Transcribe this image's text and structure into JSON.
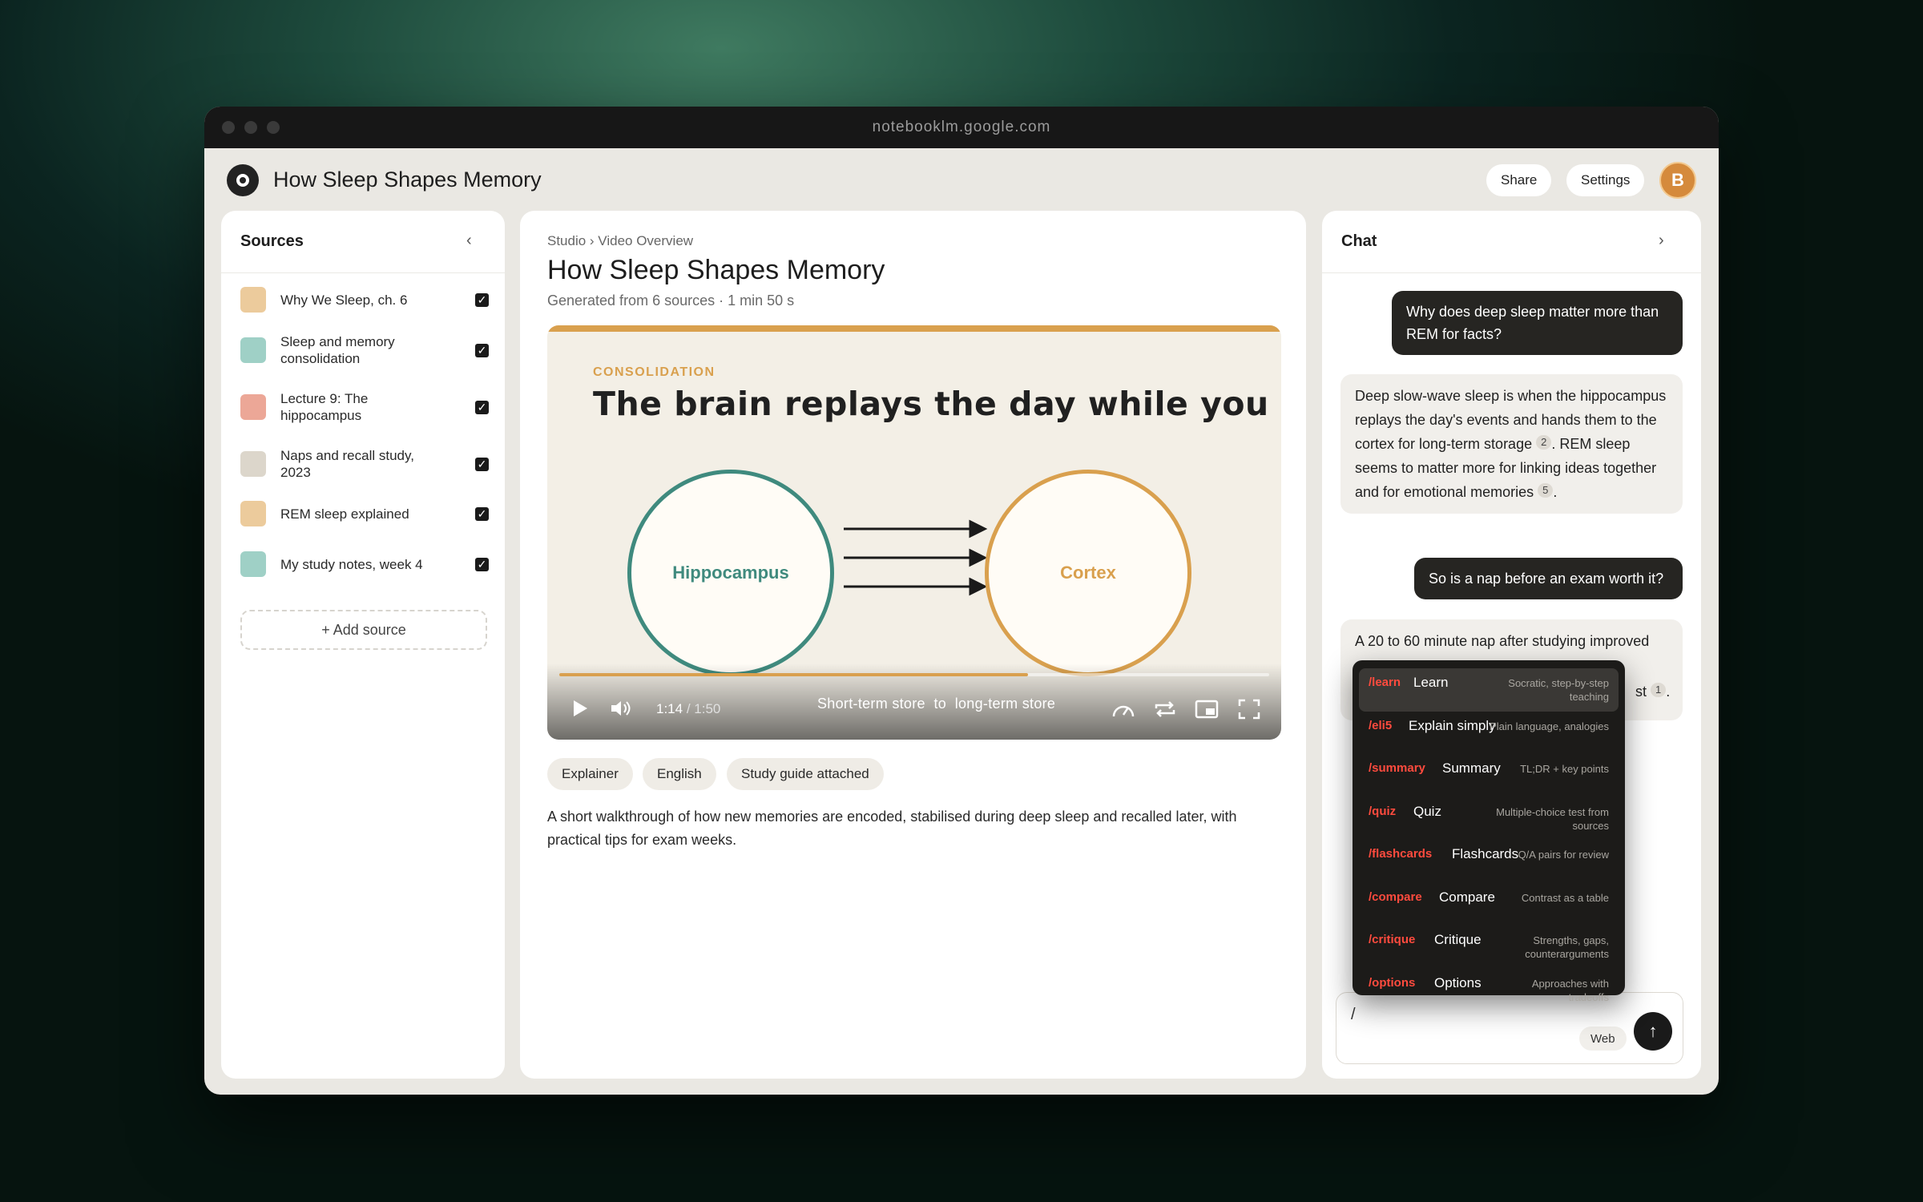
{
  "browser": {
    "url": "notebooklm.google.com"
  },
  "app": {
    "title": "How Sleep Shapes Memory",
    "share_label": "Share",
    "settings_label": "Settings",
    "avatar_initial": "B"
  },
  "sources": {
    "title": "Sources",
    "collapse_icon": "chevron-left-icon",
    "items": [
      {
        "label": "Why We Sleep, ch. 6",
        "color": "#eccb9c",
        "checked": true
      },
      {
        "label": "Sleep and memory consolidation",
        "color": "#9fd0c6",
        "checked": true
      },
      {
        "label": "Lecture 9: The hippocampus",
        "color": "#eca797",
        "checked": true
      },
      {
        "label": "Naps and recall study, 2023",
        "color": "#dcd6cb",
        "checked": true
      },
      {
        "label": "REM sleep explained",
        "color": "#eccb9c",
        "checked": true
      },
      {
        "label": "My study notes, week 4",
        "color": "#9fd0c6",
        "checked": true
      }
    ],
    "add_label": "+ Add source"
  },
  "studio": {
    "breadcrumb": "Studio › Video Overview",
    "title": "How Sleep Shapes Memory",
    "subtitle": "Generated from 6 sources · 1 min 50 s",
    "player": {
      "slide_kicker": "CONSOLIDATION",
      "slide_title": "The brain replays the day while you sleep",
      "left_node": "Hippocampus",
      "right_node": "Cortex",
      "current_time": "1:14",
      "duration": "1:50",
      "progress": 0.66,
      "caption_left": "Short-term store",
      "caption_mid": "to",
      "caption_right": "long-term store",
      "accent_color": "#d9a04e",
      "teal_color": "#3f8a7e"
    },
    "chips": [
      "Explainer",
      "English",
      "Study guide attached"
    ],
    "description": "A short walkthrough of how new memories are encoded, stabilised during deep sleep and recalled later, with practical tips for exam weeks."
  },
  "chat": {
    "title": "Chat",
    "expand_icon": "chevron-right-icon",
    "messages": [
      {
        "role": "user",
        "text": "Why does deep sleep matter more than REM for facts?"
      },
      {
        "role": "assistant",
        "part1": "Deep slow-wave sleep is when the hippocampus replays the day's events and hands them to the cortex for long-term storage",
        "cite1": "2",
        "part2": ". REM sleep seems to matter more for linking ideas together and for emotional memories",
        "cite2": "5",
        "part3": "."
      },
      {
        "role": "user",
        "text": "So is a nap before an exam worth it?"
      },
      {
        "role": "assistant",
        "text_visible": "A 20 to 60 minute nap after studying improved",
        "tail": "st",
        "cite": "1",
        "end": "."
      }
    ],
    "command_menu": [
      {
        "command": "/learn",
        "name": "Learn",
        "desc": "Socratic, step-by-step teaching",
        "selected": true
      },
      {
        "command": "/eli5",
        "name": "Explain simply",
        "desc": "Plain language, analogies"
      },
      {
        "command": "/summary",
        "name": "Summary",
        "desc": "TL;DR + key points"
      },
      {
        "command": "/quiz",
        "name": "Quiz",
        "desc": "Multiple-choice test from sources"
      },
      {
        "command": "/flashcards",
        "name": "Flashcards",
        "desc": "Q/A pairs for review"
      },
      {
        "command": "/compare",
        "name": "Compare",
        "desc": "Contrast as a table"
      },
      {
        "command": "/critique",
        "name": "Critique",
        "desc": "Strengths, gaps, counterarguments"
      },
      {
        "command": "/options",
        "name": "Options",
        "desc": "Approaches with tradeoffs"
      }
    ],
    "input_value": "/",
    "web_label": "Web",
    "send_icon": "arrow-up-icon"
  }
}
